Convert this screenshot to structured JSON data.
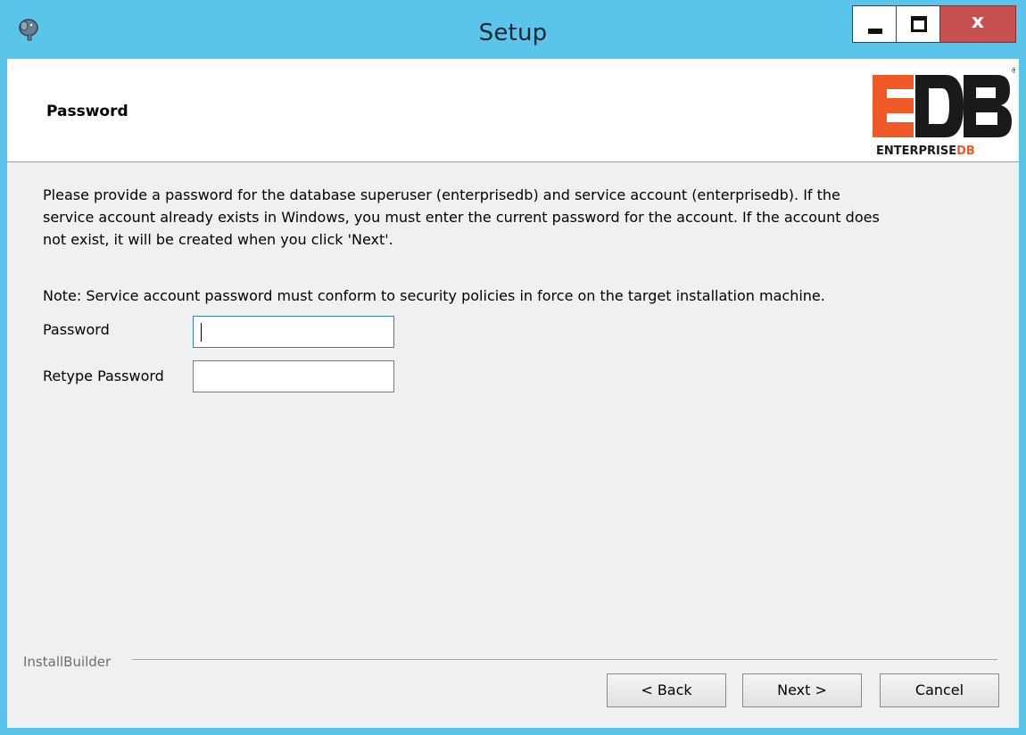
{
  "window": {
    "title": "Setup",
    "close_glyph": "x",
    "app_icon": "postgresql-elephant-icon"
  },
  "header": {
    "page_title": "Password",
    "logo": {
      "mark": "EDB",
      "wordmark_a": "ENTERPRISE",
      "wordmark_b": "DB",
      "registered": "®"
    }
  },
  "content": {
    "description_line1": "Please provide a password for the database superuser (enterprisedb) and service account (enterprisedb). If the",
    "description_line2": "service account already exists in Windows, you must enter the current password for the account. If the account does",
    "description_line3": "not exist, it will be created when you click 'Next'.",
    "note": "Note: Service account password must conform to security policies in force on the target installation machine.",
    "password_label": "Password",
    "password_value": "",
    "retype_label": "Retype Password",
    "retype_value": ""
  },
  "footer": {
    "brand": "InstallBuilder",
    "back_label": "< Back",
    "next_label": "Next >",
    "cancel_label": "Cancel"
  },
  "colors": {
    "titlebar": "#5bc4ea",
    "close_button": "#c75050",
    "logo_orange": "#f05a28",
    "logo_dark": "#1a1a1a"
  }
}
